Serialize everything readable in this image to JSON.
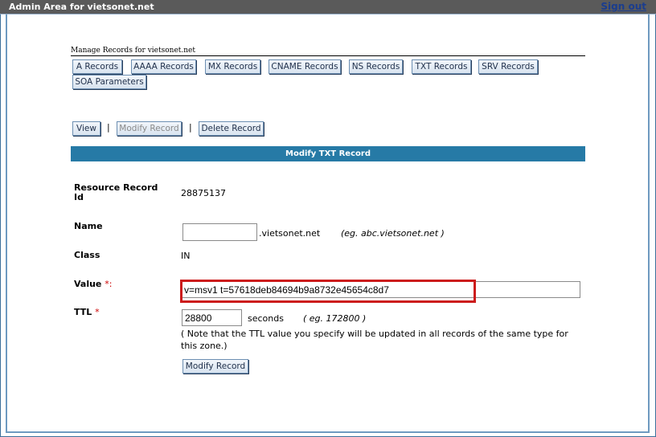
{
  "header": {
    "title": "Admin Area for vietsonet.net",
    "signout_label": "Sign out"
  },
  "manage": {
    "heading": "Manage Records for vietsonet.net",
    "record_tabs": [
      "A Records",
      "AAAA Records",
      "MX Records",
      "CNAME Records",
      "NS Records",
      "TXT Records",
      "SRV Records",
      "SOA Parameters"
    ]
  },
  "actions": {
    "view_label": "View",
    "modify_label": "Modify Record",
    "delete_label": "Delete Record",
    "separator": "|"
  },
  "form": {
    "title": "Modify TXT Record",
    "resource_id_label": "Resource Record Id",
    "resource_id_value": "28875137",
    "name_label": "Name",
    "name_value": "",
    "name_suffix": ".vietsonet.net",
    "name_hint": "(eg. abc.vietsonet.net )",
    "class_label": "Class",
    "class_value": "IN",
    "value_label": "Value",
    "value_required_mark": "*:",
    "value_value": "v=msv1 t=57618deb84694b9a8732e45654c8d7",
    "ttl_label": "TTL",
    "ttl_required_mark": "*",
    "ttl_value": "28800",
    "ttl_unit": "seconds",
    "ttl_hint": "( eg. 172800 )",
    "ttl_note": "( Note that the TTL value you specify will be updated in all records of the same type for this zone.)",
    "submit_label": "Modify Record"
  },
  "colors": {
    "header_bar": "#267aa6",
    "highlight_box": "#cc1c1c",
    "required_mark": "#cc0000"
  }
}
